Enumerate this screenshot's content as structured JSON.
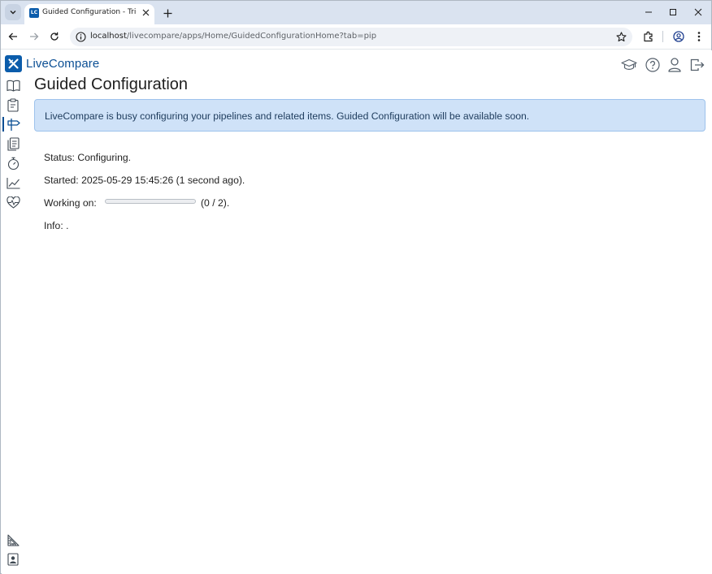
{
  "browser": {
    "tab_title": "Guided Configuration - Tricentis LiveCompare",
    "favicon_text": "LC",
    "url_host": "localhost",
    "url_path": "/livecompare/apps/Home/GuidedConfigurationHome?tab=pip"
  },
  "app": {
    "logo_text": "LiveCompare",
    "brand_color": "#0b5cab",
    "header_icons": [
      "graduation-cap-icon",
      "help-icon",
      "user-icon",
      "logout-icon"
    ],
    "sidebar_items": [
      {
        "icon": "book-icon",
        "active": false
      },
      {
        "icon": "clipboard-icon",
        "active": false
      },
      {
        "icon": "signpost-icon",
        "active": true
      },
      {
        "icon": "documents-icon",
        "active": false
      },
      {
        "icon": "stopwatch-icon",
        "active": false
      },
      {
        "icon": "line-chart-icon",
        "active": false
      },
      {
        "icon": "heartbeat-icon",
        "active": false
      }
    ],
    "sidebar_bottom_items": [
      {
        "icon": "ruler-icon"
      },
      {
        "icon": "contact-card-icon"
      }
    ]
  },
  "page": {
    "title": "Guided Configuration",
    "banner_text": "LiveCompare is busy configuring your pipelines and related items. Guided Configuration will be available soon.",
    "status_text": "Status: Configuring.",
    "started_text": "Started: 2025-05-29 15:45:26 (1 second ago).",
    "working_on_label": "Working on:",
    "progress_fraction": 0,
    "progress_count": "(0 / 2).",
    "info_text": "Info: ."
  }
}
